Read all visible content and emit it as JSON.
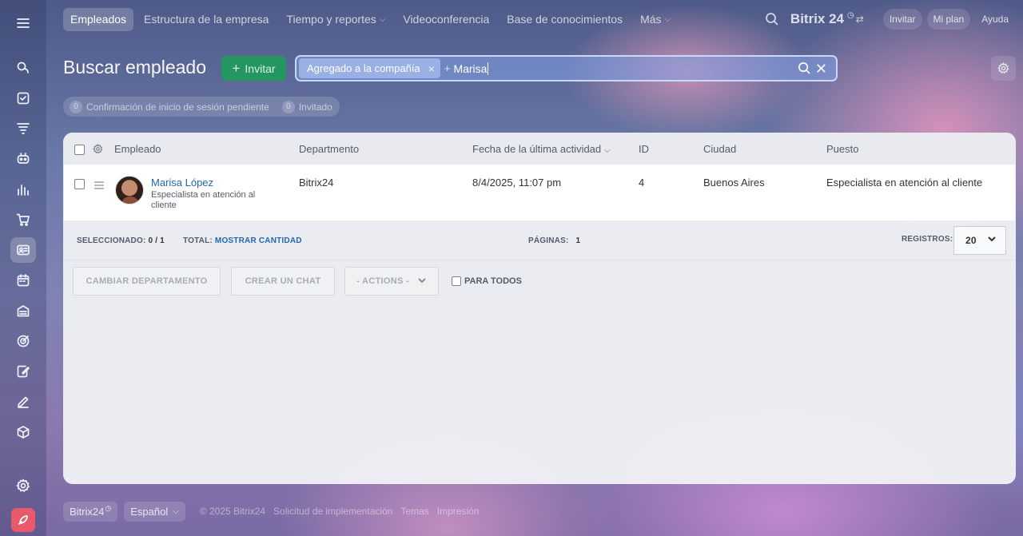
{
  "nav": {
    "tabs": [
      {
        "label": "Empleados",
        "active": true
      },
      {
        "label": "Estructura de la empresa"
      },
      {
        "label": "Tiempo y reportes",
        "dropdown": true
      },
      {
        "label": "Videoconferencia"
      },
      {
        "label": "Base de conocimientos"
      },
      {
        "label": "Más",
        "dropdown": true
      }
    ],
    "logo": "Bitrix 24",
    "invite": "Invitar",
    "my_plan": "Mi plan",
    "help": "Ayuda"
  },
  "sidebar": {
    "icons": [
      "messenger-icon",
      "tasks-icon",
      "feed-icon",
      "crm-icon",
      "analytics-icon",
      "shop-icon",
      "employees-icon",
      "calendar-icon",
      "inventory-icon",
      "goals-icon",
      "sign-icon",
      "edit-icon",
      "box-icon",
      "settings-icon",
      "rocket-icon"
    ]
  },
  "page": {
    "title": "Buscar empleado",
    "invite_button": "Invitar",
    "search": {
      "chip": "Agregado a la compañía",
      "plus": "+",
      "query": "Marisa"
    },
    "counters": [
      {
        "count": "0",
        "label": "Confirmación de inicio de sesión pendiente"
      },
      {
        "count": "0",
        "label": "Invitado"
      }
    ]
  },
  "table": {
    "headers": {
      "employee": "Empleado",
      "department": "Departmento",
      "last_activity": "Fecha de la última actividad",
      "id": "ID",
      "city": "Ciudad",
      "position": "Puesto"
    },
    "rows": [
      {
        "name": "Marisa López",
        "subtitle": "Especialista en atención al cliente",
        "department": "Bitrix24",
        "last_activity": "8/4/2025, 11:07 pm",
        "id": "4",
        "city": "Buenos Aires",
        "position": "Especialista en atención al cliente"
      }
    ],
    "footer": {
      "selected_label": "SELECCIONADO:",
      "selected_value": "0 / 1",
      "total_label": "TOTAL:",
      "total_link": "MOSTRAR CANTIDAD",
      "pages_label": "PÁGINAS:",
      "pages_value": "1",
      "records_label": "REGISTROS:",
      "records_value": "20"
    },
    "actions": {
      "change_department": "CAMBIAR DEPARTAMENTO",
      "create_chat": "CREAR UN CHAT",
      "actions_select": "- ACTIONS -",
      "for_all": "PARA TODOS"
    }
  },
  "footer": {
    "brand": "Bitrix24",
    "language": "Español",
    "copyright": "© 2025 Bitrix24",
    "implementation": "Solicitud de implementación",
    "themes": "Temas",
    "print": "Impresión"
  }
}
